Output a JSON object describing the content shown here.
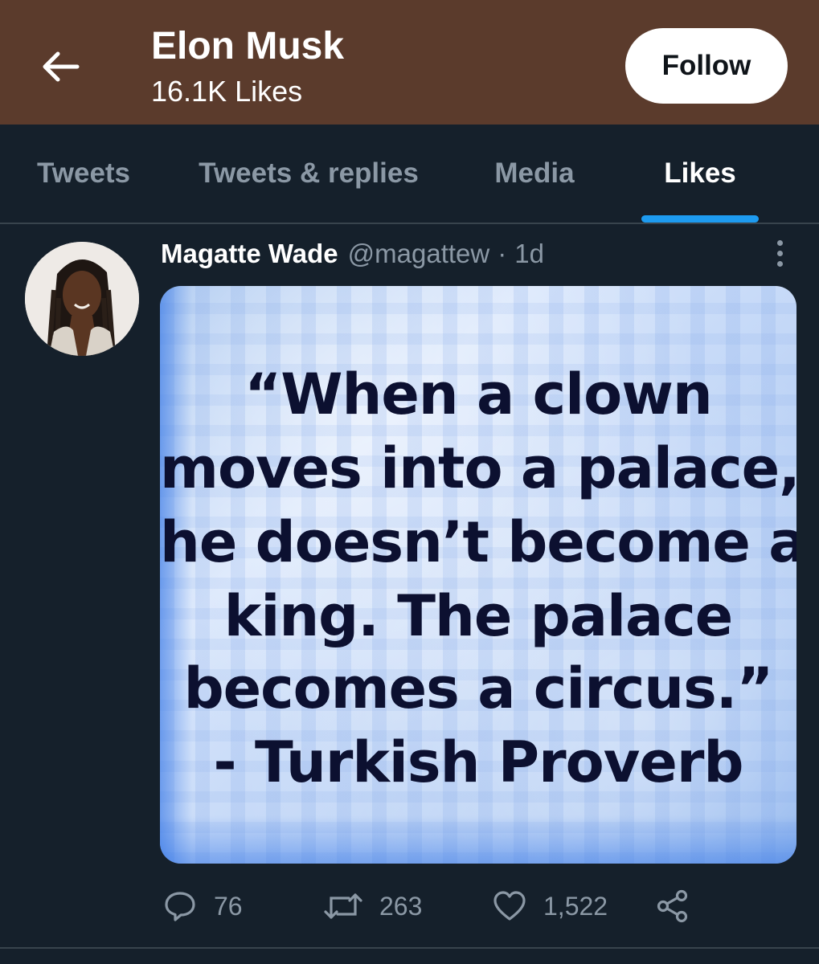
{
  "header": {
    "title": "Elon Musk",
    "subtitle": "16.1K Likes",
    "follow_label": "Follow",
    "back_icon": "arrow-left-icon"
  },
  "tabs": [
    {
      "label": "Tweets",
      "active": false
    },
    {
      "label": "Tweets & replies",
      "active": false
    },
    {
      "label": "Media",
      "active": false
    },
    {
      "label": "Likes",
      "active": true
    }
  ],
  "tweet": {
    "author_name": "Magatte Wade",
    "author_handle": "@magattew",
    "separator": "·",
    "time": "1d",
    "media_text_lines": [
      "“When a clown",
      "moves into a palace,",
      "he doesn’t become a",
      "king. The palace",
      "becomes a circus.”",
      "- Turkish Proverb"
    ],
    "actions": {
      "replies": "76",
      "retweets": "263",
      "likes": "1,522"
    }
  },
  "colors": {
    "header_bg": "#5b3b2c",
    "page_bg": "#15202b",
    "accent": "#1d9bf0",
    "muted_text": "#8b98a5"
  }
}
